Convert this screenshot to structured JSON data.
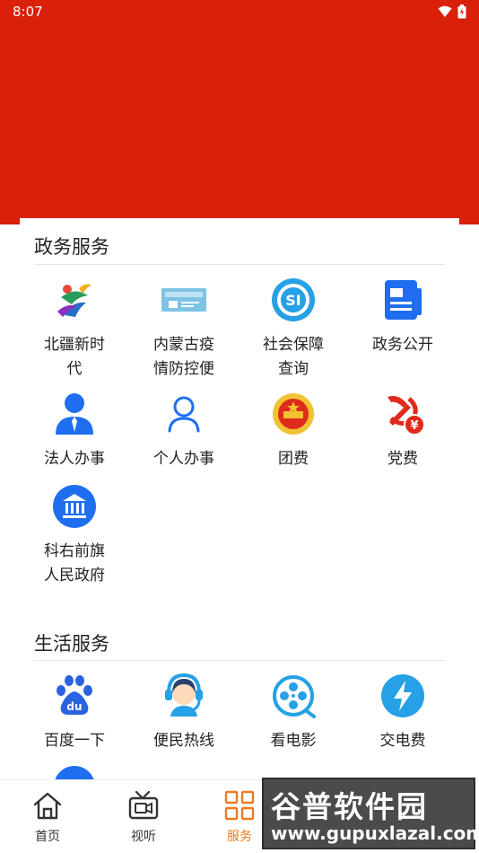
{
  "status_bar": {
    "time": "8:07"
  },
  "gov_services": {
    "title": "政务服务",
    "items": [
      {
        "label_line1": "北疆新时",
        "label_line2": "代",
        "icon": "ribbon-logo-icon"
      },
      {
        "label_line1": "内蒙古疫",
        "label_line2": "情防控便",
        "icon": "epidemic-card-icon"
      },
      {
        "label_line1": "社会保障",
        "label_line2": "查询",
        "icon": "social-security-icon"
      },
      {
        "label_line1": "政务公开",
        "label_line2": "",
        "icon": "document-icon"
      },
      {
        "label_line1": "法人办事",
        "label_line2": "",
        "icon": "legal-person-icon"
      },
      {
        "label_line1": "个人办事",
        "label_line2": "",
        "icon": "person-icon"
      },
      {
        "label_line1": "团费",
        "label_line2": "",
        "icon": "youth-league-icon"
      },
      {
        "label_line1": "党费",
        "label_line2": "",
        "icon": "party-fee-icon"
      },
      {
        "label_line1": "科右前旗",
        "label_line2": "人民政府",
        "icon": "government-building-icon"
      }
    ]
  },
  "life_services": {
    "title": "生活服务",
    "items": [
      {
        "label_line1": "百度一下",
        "icon": "baidu-paw-icon"
      },
      {
        "label_line1": "便民热线",
        "icon": "hotline-headset-icon"
      },
      {
        "label_line1": "看电影",
        "icon": "film-reel-icon"
      },
      {
        "label_line1": "交电费",
        "icon": "lightning-icon"
      }
    ]
  },
  "bottom_nav": {
    "items": [
      {
        "label": "首页",
        "icon": "home-icon"
      },
      {
        "label": "视听",
        "icon": "tv-video-icon"
      },
      {
        "label": "服务",
        "icon": "grid-icon",
        "active": true
      }
    ]
  },
  "watermark": {
    "main": "谷普软件园",
    "url": "www.gupuxlazal.com"
  },
  "colors": {
    "header_red": "#d9200a",
    "accent_orange": "#ee7a22",
    "icon_blue": "#1f6ef0"
  }
}
